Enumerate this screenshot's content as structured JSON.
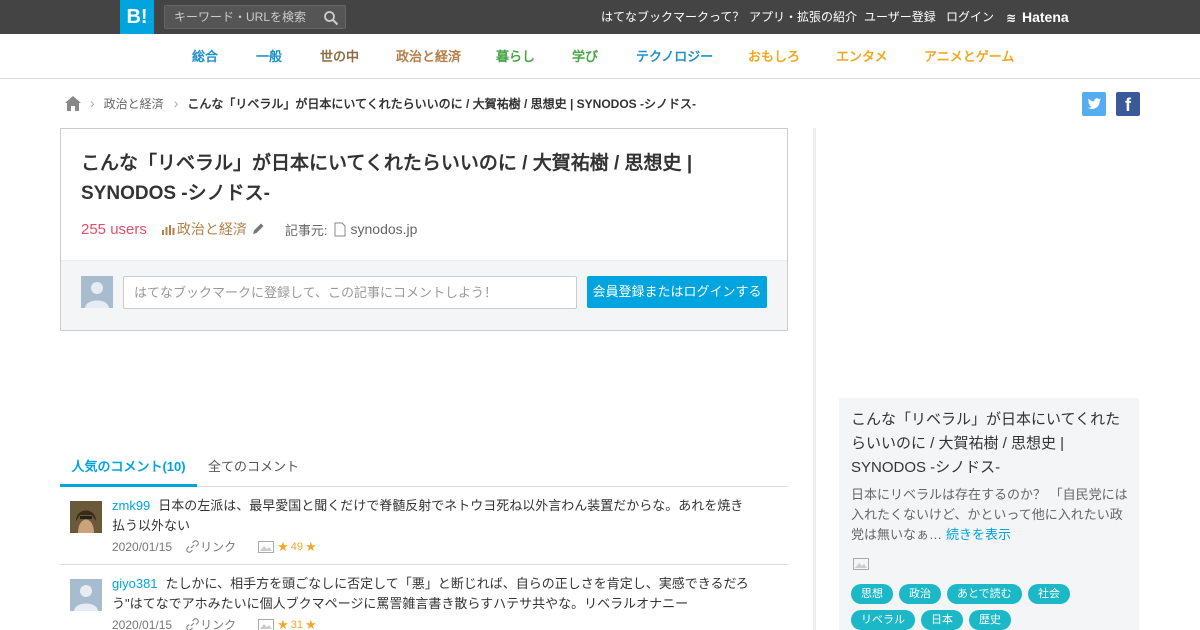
{
  "header": {
    "logo": "B!",
    "search_placeholder": "キーワード・URLを検索",
    "nav": [
      "はてなブックマークって？",
      "アプリ・拡張の紹介",
      "ユーザー登録",
      "ログイン"
    ],
    "brand": "Hatena"
  },
  "categories": [
    {
      "label": "総合",
      "color": "#1e92c7"
    },
    {
      "label": "一般",
      "color": "#1e92c7"
    },
    {
      "label": "世の中",
      "color": "#8c6e46"
    },
    {
      "label": "政治と経済",
      "color": "#b5804a"
    },
    {
      "label": "暮らし",
      "color": "#4aa449"
    },
    {
      "label": "学び",
      "color": "#4aa449"
    },
    {
      "label": "テクノロジー",
      "color": "#1e92c7"
    },
    {
      "label": "おもしろ",
      "color": "#f0a81e"
    },
    {
      "label": "エンタメ",
      "color": "#f0a81e"
    },
    {
      "label": "アニメとゲーム",
      "color": "#f0a81e"
    }
  ],
  "breadcrumb": {
    "category": "政治と経済",
    "title": "こんな「リベラル」が日本にいてくれたらいいのに / 大賀祐樹 / 思想史 | SYNODOS -シノドス-"
  },
  "entry": {
    "title": "こんな「リベラル」が日本にいてくれたらいいのに / 大賀祐樹 / 思想史 | SYNODOS -シノドス-",
    "users": "255 users",
    "category": "政治と経済",
    "source_label": "記事元:",
    "source_host": "synodos.jp"
  },
  "comment_form": {
    "placeholder": "はてなブックマークに登録して、この記事にコメントしよう！",
    "button": "会員登録またはログインする"
  },
  "tabs": {
    "popular": "人気のコメント(10)",
    "all": "全てのコメント"
  },
  "comments": [
    {
      "user": "zmk99",
      "text": "日本の左派は、最早愛国と聞くだけで脊髄反射でネトウヨ死ね以外言わん装置だからな。あれを焼き払う以外ない",
      "date": "2020/01/15",
      "link_label": "リンク",
      "stars": "49"
    },
    {
      "user": "giyo381",
      "text": "たしかに、相手方を頭ごなしに否定して「悪」と断じれば、自らの正しさを肯定し、実感できるだろう\"はてなでアホみたいに個人ブクマページに罵詈雑言書き散らすハテサ共やな。リベラルオナニー",
      "date": "2020/01/15",
      "link_label": "リンク",
      "stars": "31"
    }
  ],
  "card": {
    "title": "こんな「リベラル」が日本にいてくれたらいいのに / 大賀祐樹 / 思想史 | SYNODOS -シノドス-",
    "description": "日本にリベラルは存在するのか？ 「自民党には入れたくないけど、かといって他に入れたい政党は無いなぁ…",
    "more": "続きを表示",
    "tags": [
      "思想",
      "政治",
      "あとで読む",
      "社会",
      "リベラル",
      "日本",
      "歴史"
    ]
  },
  "colors": {
    "accent": "#00a4de",
    "users": "#e14e6c",
    "star": "#f5a623",
    "tag": "#1cb8c8"
  }
}
